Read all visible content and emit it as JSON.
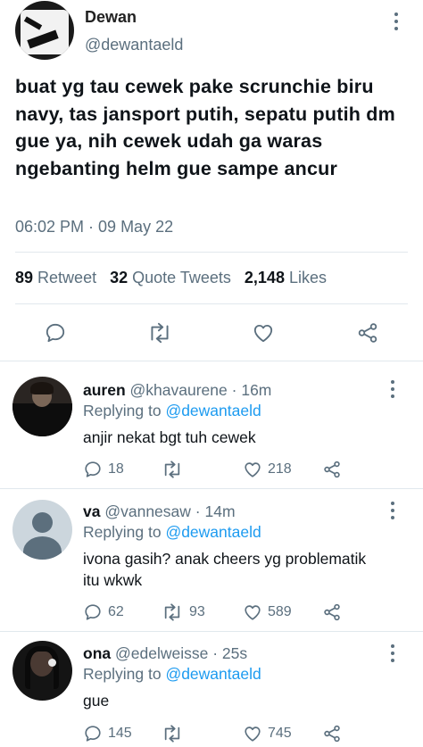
{
  "tweet": {
    "author_name": "Dewan",
    "author_handle": "@dewantaeld",
    "text": "buat yg tau cewek pake scrunchie biru navy, tas jansport putih, sepatu putih dm gue ya, nih cewek udah ga waras ngebanting helm gue sampe ancur",
    "timestamp": "06:02 PM · 09 May 22",
    "stats": {
      "retweets_count": "89",
      "retweets_label": "Retweet",
      "quotes_count": "32",
      "quotes_label": "Quote Tweets",
      "likes_count": "2,148",
      "likes_label": "Likes"
    },
    "icons": [
      "reply-icon",
      "retweet-icon",
      "like-icon",
      "share-icon"
    ]
  },
  "replies": [
    {
      "name": "auren",
      "handle": "@khavaurene",
      "age": "· 16m",
      "replying_label": "Replying to",
      "replying_to": "@dewantaeld",
      "text": "anjir nekat bgt tuh cewek",
      "reply_count": "18",
      "retweet_count": "",
      "like_count": "218"
    },
    {
      "name": "va",
      "handle": "@vannesaw",
      "age": "· 14m",
      "replying_label": "Replying to",
      "replying_to": "@dewantaeld",
      "text": "ivona gasih? anak cheers yg problematik itu wkwk",
      "reply_count": "62",
      "retweet_count": "93",
      "like_count": "589"
    },
    {
      "name": "ona",
      "handle": "@edelweisse",
      "age": "· 25s",
      "replying_label": "Replying to",
      "replying_to": "@dewantaeld",
      "text": "gue",
      "reply_count": "145",
      "retweet_count": "",
      "like_count": "745"
    }
  ],
  "colors": {
    "accent": "#1d9bf0",
    "secondary_text": "#5b6f7e",
    "divider": "#e1e8ed"
  }
}
